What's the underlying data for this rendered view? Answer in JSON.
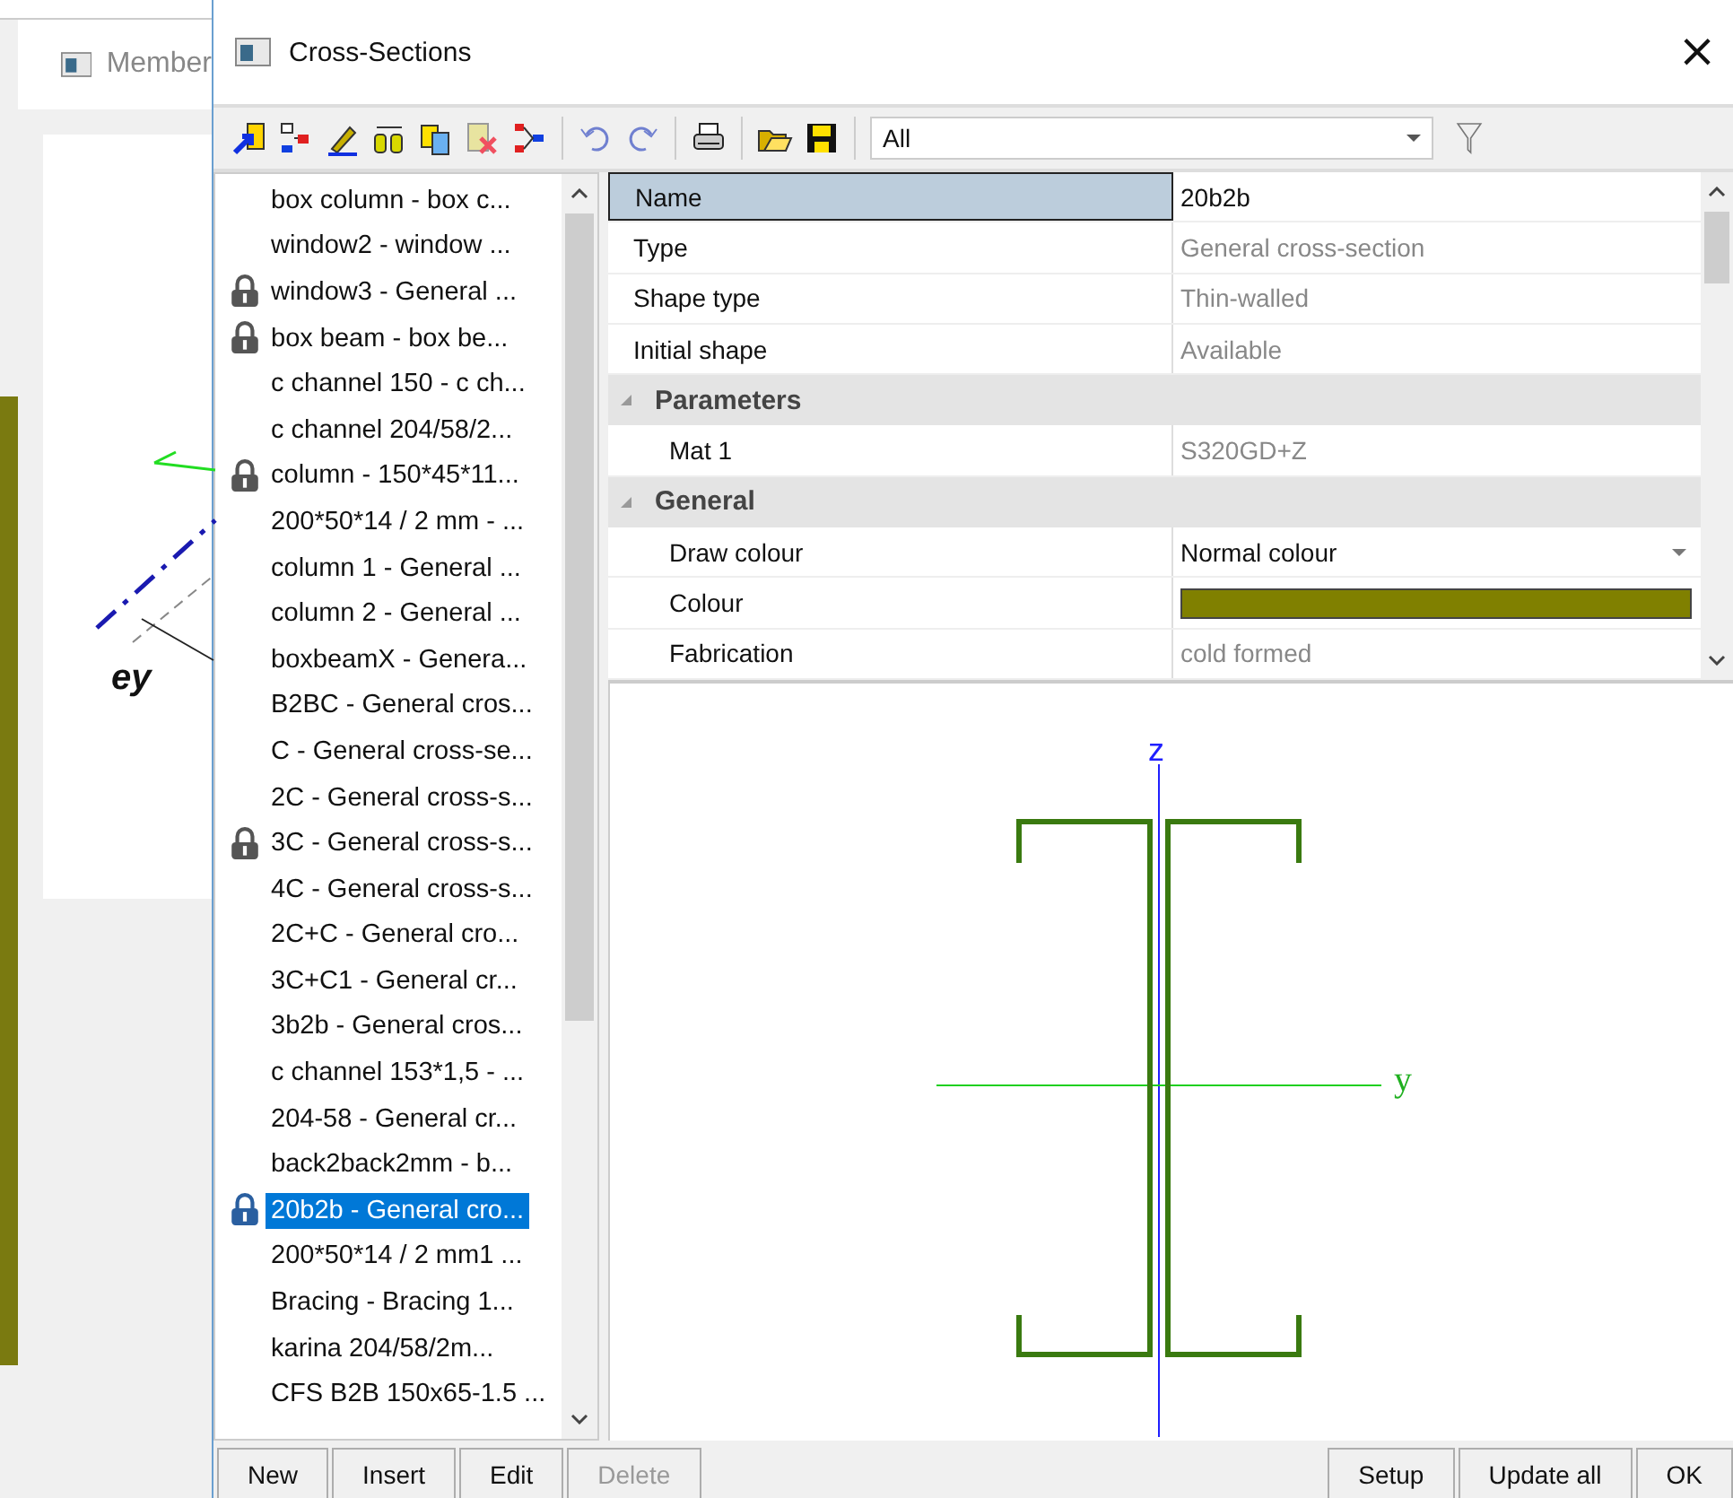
{
  "background_window": {
    "title": "Member",
    "axis_label": "ey"
  },
  "window": {
    "title": "Cross-Sections",
    "close": "×"
  },
  "toolbar": {
    "filter": {
      "value": "All"
    }
  },
  "sections": [
    {
      "label": "box column - box c...",
      "locked": false,
      "selected": false
    },
    {
      "label": "window2 - window ...",
      "locked": false,
      "selected": false
    },
    {
      "label": "window3 - General ...",
      "locked": true,
      "selected": false
    },
    {
      "label": "box beam  - box be...",
      "locked": true,
      "selected": false
    },
    {
      "label": "c channel 150 - c ch...",
      "locked": false,
      "selected": false
    },
    {
      "label": "c channel 204/58/2...",
      "locked": false,
      "selected": false
    },
    {
      "label": "column - 150*45*11...",
      "locked": true,
      "selected": false
    },
    {
      "label": "200*50*14 / 2 mm - ...",
      "locked": false,
      "selected": false
    },
    {
      "label": "column 1 - General ...",
      "locked": false,
      "selected": false
    },
    {
      "label": "column 2 - General ...",
      "locked": false,
      "selected": false
    },
    {
      "label": "boxbeamX - Genera...",
      "locked": false,
      "selected": false
    },
    {
      "label": "B2BC - General cros...",
      "locked": false,
      "selected": false
    },
    {
      "label": "C - General cross-se...",
      "locked": false,
      "selected": false
    },
    {
      "label": "2C - General cross-s...",
      "locked": false,
      "selected": false
    },
    {
      "label": "3C - General cross-s...",
      "locked": true,
      "selected": false
    },
    {
      "label": "4C - General cross-s...",
      "locked": false,
      "selected": false
    },
    {
      "label": "2C+C - General cro...",
      "locked": false,
      "selected": false
    },
    {
      "label": "3C+C1 - General cr...",
      "locked": false,
      "selected": false
    },
    {
      "label": "3b2b - General cros...",
      "locked": false,
      "selected": false
    },
    {
      "label": "c channel 153*1,5 - ...",
      "locked": false,
      "selected": false
    },
    {
      "label": "204-58 - General cr...",
      "locked": false,
      "selected": false
    },
    {
      "label": "back2back2mm - b...",
      "locked": false,
      "selected": false
    },
    {
      "label": "20b2b - General cro...",
      "locked": true,
      "selected": true
    },
    {
      "label": "200*50*14 / 2 mm1 ...",
      "locked": false,
      "selected": false
    },
    {
      "label": "Bracing - Bracing 1...",
      "locked": false,
      "selected": false
    },
    {
      "label": "karina  204/58/2m...",
      "locked": false,
      "selected": false
    },
    {
      "label": "CFS B2B 150x65-1.5 ...",
      "locked": false,
      "selected": false
    }
  ],
  "properties": [
    {
      "kind": "text",
      "label": "Name",
      "value": "20b2b",
      "greyed": false,
      "selected": true
    },
    {
      "kind": "text",
      "label": "Type",
      "value": "General cross-section",
      "greyed": true,
      "selected": false
    },
    {
      "kind": "text",
      "label": "Shape type",
      "value": "Thin-walled",
      "greyed": true,
      "selected": false
    },
    {
      "kind": "text",
      "label": "Initial shape",
      "value": "Available",
      "greyed": true,
      "selected": false
    },
    {
      "kind": "group",
      "label": "Parameters",
      "expanded": true,
      "children": [
        {
          "kind": "text",
          "label": "Mat 1",
          "value": "S320GD+Z",
          "greyed": true,
          "selected": false
        }
      ]
    },
    {
      "kind": "group",
      "label": "General",
      "expanded": true,
      "children": [
        {
          "kind": "dropdown",
          "label": "Draw colour",
          "value": "Normal colour",
          "greyed": false,
          "selected": false
        },
        {
          "kind": "color",
          "label": "Colour",
          "color": "#808000",
          "selected": false
        },
        {
          "kind": "text",
          "label": "Fabrication",
          "value": "cold formed",
          "greyed": true,
          "selected": false
        }
      ]
    }
  ],
  "preview": {
    "z_label": "z",
    "y_label": "y"
  },
  "buttons_left": [
    {
      "label": "New",
      "disabled": false
    },
    {
      "label": "Insert",
      "disabled": false
    },
    {
      "label": "Edit",
      "disabled": false
    },
    {
      "label": "Delete",
      "disabled": true
    }
  ],
  "buttons_right": [
    {
      "label": "Setup",
      "disabled": false
    },
    {
      "label": "Update all",
      "disabled": false
    },
    {
      "label": "OK",
      "disabled": false
    }
  ]
}
